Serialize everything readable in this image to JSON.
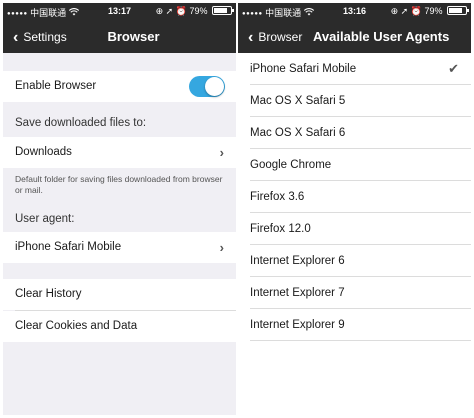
{
  "status_left": {
    "carrier": "中国联通",
    "time": "13:17",
    "battery": "79%",
    "battery_level": 0.79
  },
  "status_right": {
    "carrier": "中国联通",
    "time": "13:16",
    "battery": "79%",
    "battery_level": 0.79
  },
  "browser_screen": {
    "back_label": "Settings",
    "title": "Browser",
    "enable_browser_label": "Enable Browser",
    "enable_browser_on": true,
    "save_files_label": "Save downloaded files to:",
    "downloads_label": "Downloads",
    "downloads_footer": "Default folder for saving files downloaded from browser or mail.",
    "user_agent_label": "User agent:",
    "user_agent_value": "iPhone Safari Mobile",
    "clear_history_label": "Clear History",
    "clear_cookies_label": "Clear Cookies and Data"
  },
  "agents_screen": {
    "back_label": "Browser",
    "title": "Available User Agents",
    "selected": "iPhone Safari Mobile",
    "agents": [
      "iPhone Safari Mobile",
      "Mac OS X Safari 5",
      "Mac OS X Safari 6",
      "Google Chrome",
      "Firefox 3.6",
      "Firefox 12.0",
      "Internet Explorer 6",
      "Internet Explorer 7",
      "Internet Explorer 9"
    ]
  },
  "colors": {
    "bar": "#2b2b2b",
    "toggle_on": "#35a7e0",
    "group_bg": "#f0eff4"
  },
  "icons": [
    "signal-dots-icon",
    "wifi-icon",
    "lock-rotation-icon",
    "location-icon",
    "alarm-icon",
    "battery-icon",
    "back-chevron-icon",
    "disclosure-chevron-icon",
    "checkmark-icon"
  ]
}
